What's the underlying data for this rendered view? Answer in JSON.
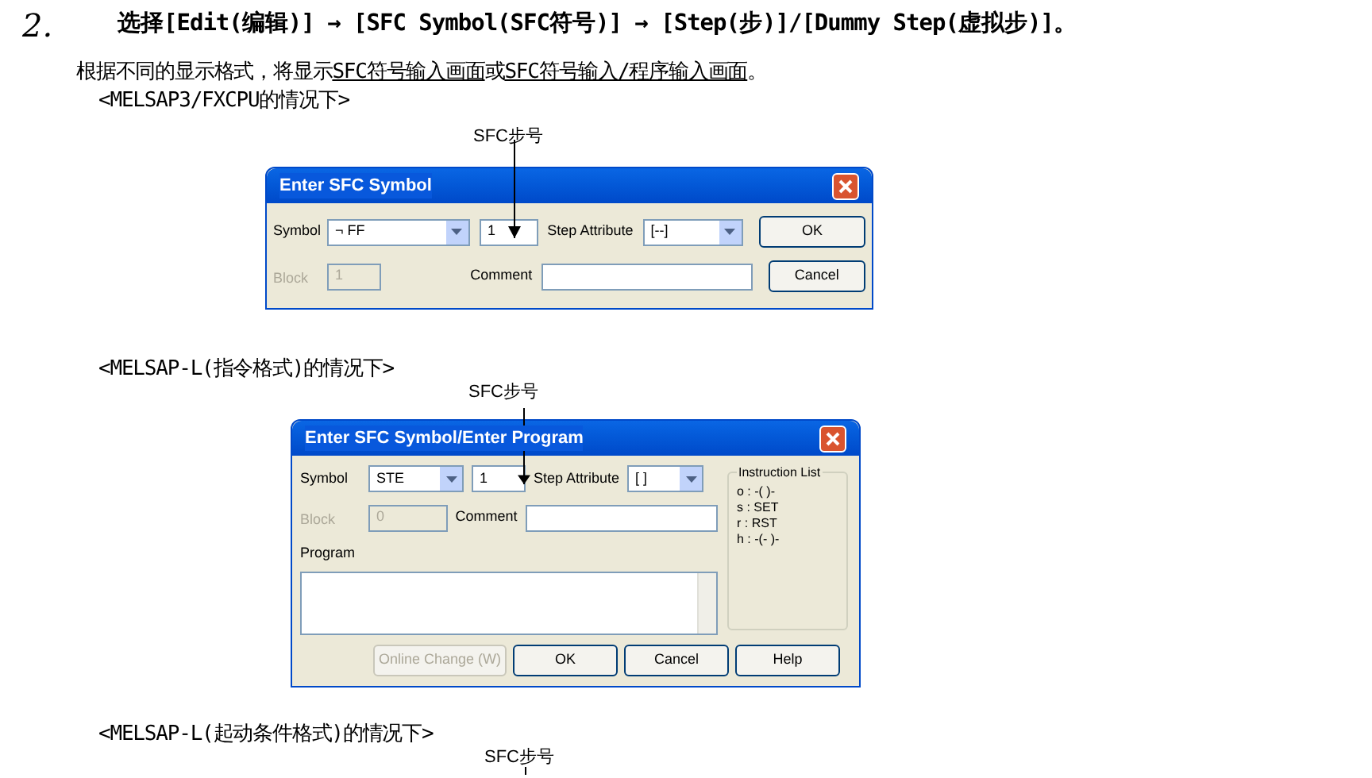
{
  "heading": {
    "number": "2.",
    "text": "选择[Edit(编辑)] → [SFC Symbol(SFC符号)] → [Step(步)]/[Dummy Step(虚拟步)]。"
  },
  "intro": [
    {
      "text": "根据不同的显示格式，将显示",
      "underlined": false
    },
    {
      "text": "SFC符号输入画面",
      "underlined": true
    },
    {
      "text": "或",
      "underlined": false
    },
    {
      "text": "SFC符号输入/程序输入画面",
      "underlined": true
    },
    {
      "text": "。",
      "underlined": false
    }
  ],
  "sections": [
    {
      "caption": "<MELSAP3/FXCPU的情况下>",
      "callout": "SFC步号",
      "dialog": {
        "kind": "symbol",
        "title": "Enter SFC Symbol",
        "symbol_label": "Symbol",
        "symbol_value": "¬ FF",
        "step_no": "1",
        "attribute_label": "Step Attribute",
        "attribute_value": "[--]",
        "block_label": "Block",
        "block_value": "1",
        "block_disabled": true,
        "comment_label": "Comment",
        "buttons": [
          {
            "label": "OK",
            "disabled": false
          },
          {
            "label": "Cancel",
            "disabled": false
          }
        ]
      }
    },
    {
      "caption": "<MELSAP-L(指令格式)的情况下>",
      "callout": "SFC步号",
      "dialog": {
        "kind": "program",
        "title": "Enter SFC Symbol/Enter Program",
        "symbol_label": "Symbol",
        "symbol_value": "STE",
        "step_no": "1",
        "attribute_label": "Step Attribute",
        "attribute_value": "[ ]",
        "block_label": "Block",
        "block_value": "0",
        "block_disabled": true,
        "comment_label": "Comment",
        "program_label": "Program",
        "instruction_title": "Instruction List",
        "instructions": [
          "o : -( )-",
          "s : SET",
          "r : RST",
          "h : -(- )-"
        ],
        "buttons": [
          {
            "label": "Online Change (W)",
            "disabled": true
          },
          {
            "label": "OK",
            "disabled": false
          },
          {
            "label": "Cancel",
            "disabled": false
          },
          {
            "label": "Help",
            "disabled": false
          }
        ]
      }
    },
    {
      "caption": "<MELSAP-L(起动条件格式)的情况下>",
      "callout": "SFC步号"
    }
  ]
}
